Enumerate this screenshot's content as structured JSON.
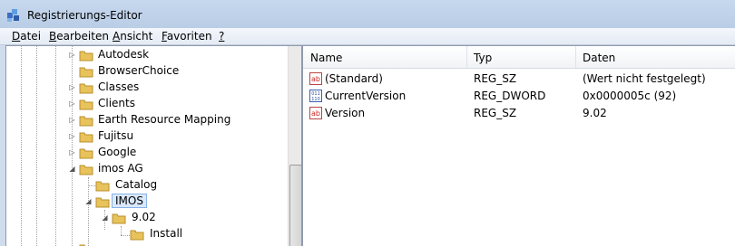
{
  "window": {
    "title": "Registrierungs-Editor"
  },
  "menu": [
    {
      "key": "D",
      "rest": "atei"
    },
    {
      "key": "B",
      "rest": "earbeiten"
    },
    {
      "key": "A",
      "rest": "nsicht"
    },
    {
      "key": "F",
      "rest": "avoriten"
    },
    {
      "key": "?",
      "rest": ""
    }
  ],
  "tree": [
    {
      "label": "Autodesk",
      "expanded": false
    },
    {
      "label": "BrowserChoice",
      "expanded": null
    },
    {
      "label": "Classes",
      "expanded": false
    },
    {
      "label": "Clients",
      "expanded": false
    },
    {
      "label": "Earth Resource Mapping",
      "expanded": false
    },
    {
      "label": "Fujitsu",
      "expanded": false
    },
    {
      "label": "Google",
      "expanded": false
    },
    {
      "label": "imos AG",
      "expanded": true
    },
    {
      "label": "Catalog",
      "expanded": null
    },
    {
      "label": "IMOS",
      "expanded": true,
      "selected": true
    },
    {
      "label": "9.02",
      "expanded": true
    },
    {
      "label": "Install",
      "expanded": null
    }
  ],
  "columns": {
    "name": "Name",
    "type": "Typ",
    "data": "Daten"
  },
  "values": [
    {
      "icon": "string-value-icon",
      "name": "(Standard)",
      "type": "REG_SZ",
      "data": "(Wert nicht festgelegt)"
    },
    {
      "icon": "dword-value-icon",
      "name": "CurrentVersion",
      "type": "REG_DWORD",
      "data": "0x0000005c (92)"
    },
    {
      "icon": "string-value-icon",
      "name": "Version",
      "type": "REG_SZ",
      "data": "9.02"
    }
  ],
  "colors": {
    "folder": "#e8c25a",
    "selection": "#d9e8fb",
    "titlebar": "#bdd0e9"
  }
}
